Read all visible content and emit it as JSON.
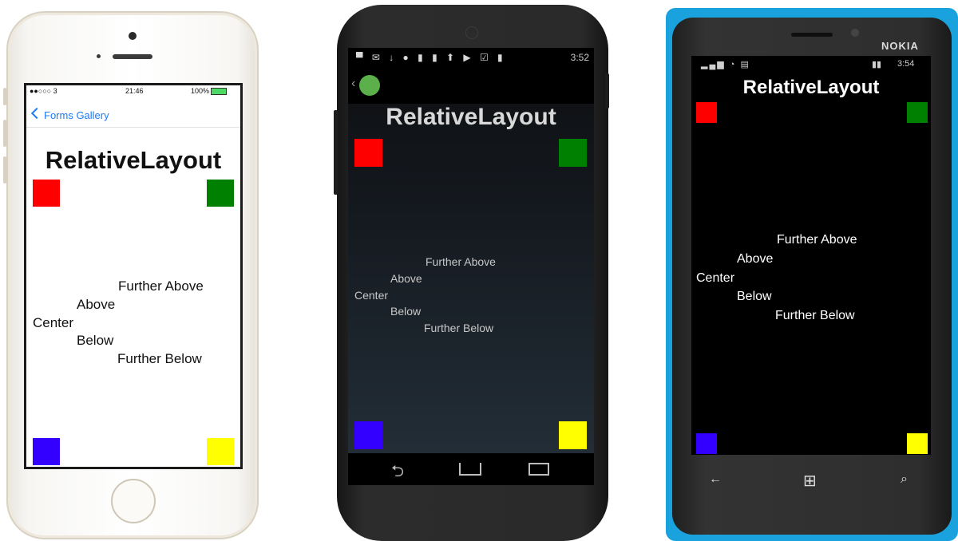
{
  "colors": {
    "red": "#ff0000",
    "green": "#008000",
    "blue": "#3300ff",
    "yellow": "#ffff00"
  },
  "page_title": "RelativeLayout",
  "labels": {
    "further_above": "Further Above",
    "above": "Above",
    "center": "Center",
    "below": "Below",
    "further_below": "Further Below"
  },
  "ios": {
    "status": {
      "carrier": "●●○○○ 3",
      "time": "21:46",
      "battery": "100%"
    },
    "nav": {
      "back_label": "Forms Gallery",
      "back_icon": "chevron-left-icon"
    }
  },
  "android": {
    "status": {
      "time": "3:52",
      "notification_icons": "▀ ✉ ↓ ● ▮ ▮ ⬆ ▶ ☑ ▮"
    },
    "app_icon": "android-app-icon",
    "nav_icons": [
      "back-icon",
      "home-icon",
      "recents-icon"
    ]
  },
  "windows_phone": {
    "brand": "NOKIA",
    "status": {
      "time": "3:54"
    },
    "softkeys": {
      "back": "←",
      "start": "⊞",
      "search": "⌕"
    }
  }
}
